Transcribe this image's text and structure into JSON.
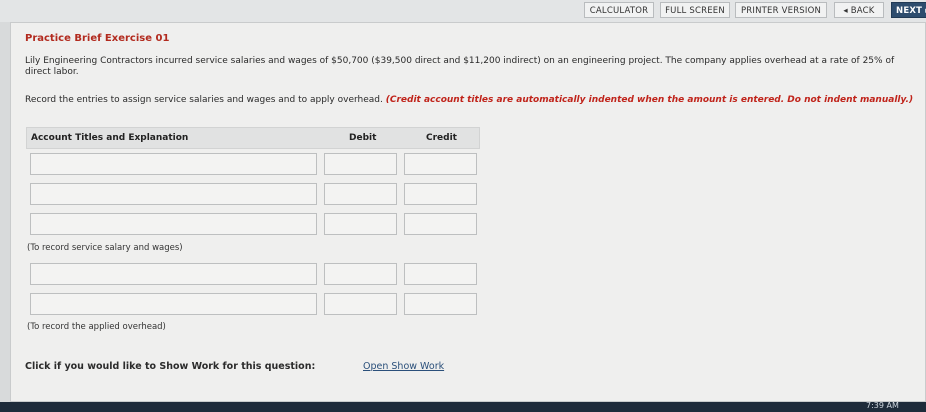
{
  "toolbar": {
    "calculator": "CALCULATOR",
    "full_screen": "FULL SCREEN",
    "printer_version": "PRINTER VERSION",
    "back": "◂ BACK",
    "next": "NEXT ▸"
  },
  "exercise": {
    "title": "Practice Brief Exercise 01",
    "problem": "Lily Engineering Contractors incurred service salaries and wages of $50,700 ($39,500 direct and $11,200 indirect) on an engineering project. The company applies overhead at a rate of 25% of direct labor.",
    "instruction": "Record the entries to assign service salaries and wages and to apply overhead.",
    "instruction_note": "(Credit account titles are automatically indented when the amount is entered. Do not indent manually.)"
  },
  "journal": {
    "col_account": "Account Titles and Explanation",
    "col_debit": "Debit",
    "col_credit": "Credit",
    "entry1_note": "(To record service salary and wages)",
    "entry2_note": "(To record the applied overhead)"
  },
  "footer": {
    "show_work_prompt": "Click if you would like to Show Work for this question:",
    "show_work_link": "Open Show Work"
  },
  "system": {
    "clock": "7:39 AM"
  }
}
